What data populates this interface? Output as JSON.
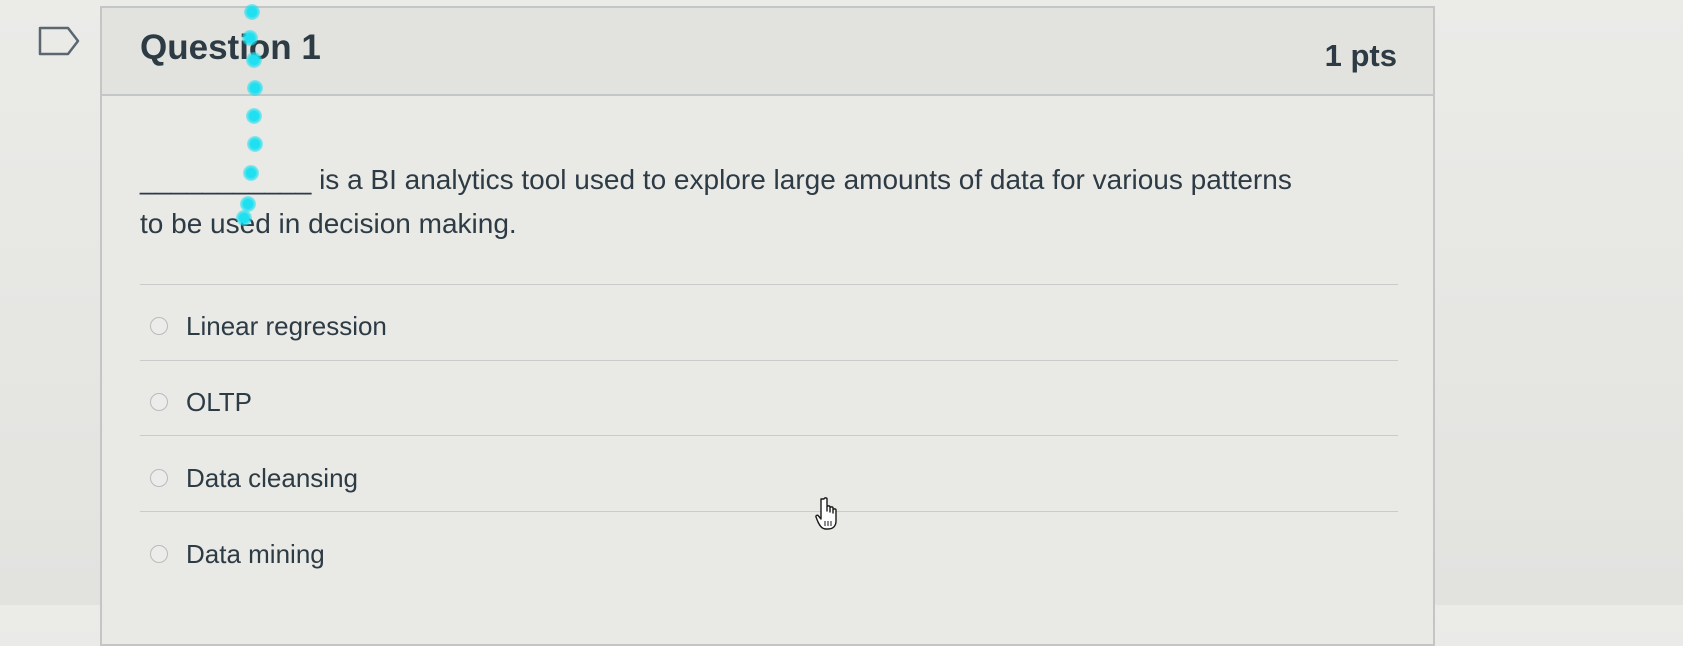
{
  "question": {
    "title": "Question 1",
    "points": "1 pts",
    "blank": "___________",
    "text": " is a BI analytics tool used to explore large amounts of data for various patterns to be used in decision making.",
    "answers": [
      {
        "label": "Linear regression",
        "selected": false
      },
      {
        "label": "OLTP",
        "selected": false
      },
      {
        "label": "Data cleansing",
        "selected": false
      },
      {
        "label": "Data mining",
        "selected": false
      }
    ]
  },
  "colors": {
    "text": "#2d3b45",
    "border": "#c3c6c6",
    "header_bg": "#e2e2df",
    "marker": "#1fe0f0"
  },
  "icons": {
    "flag": "flag-icon",
    "cursor": "hand-pointer-icon"
  }
}
